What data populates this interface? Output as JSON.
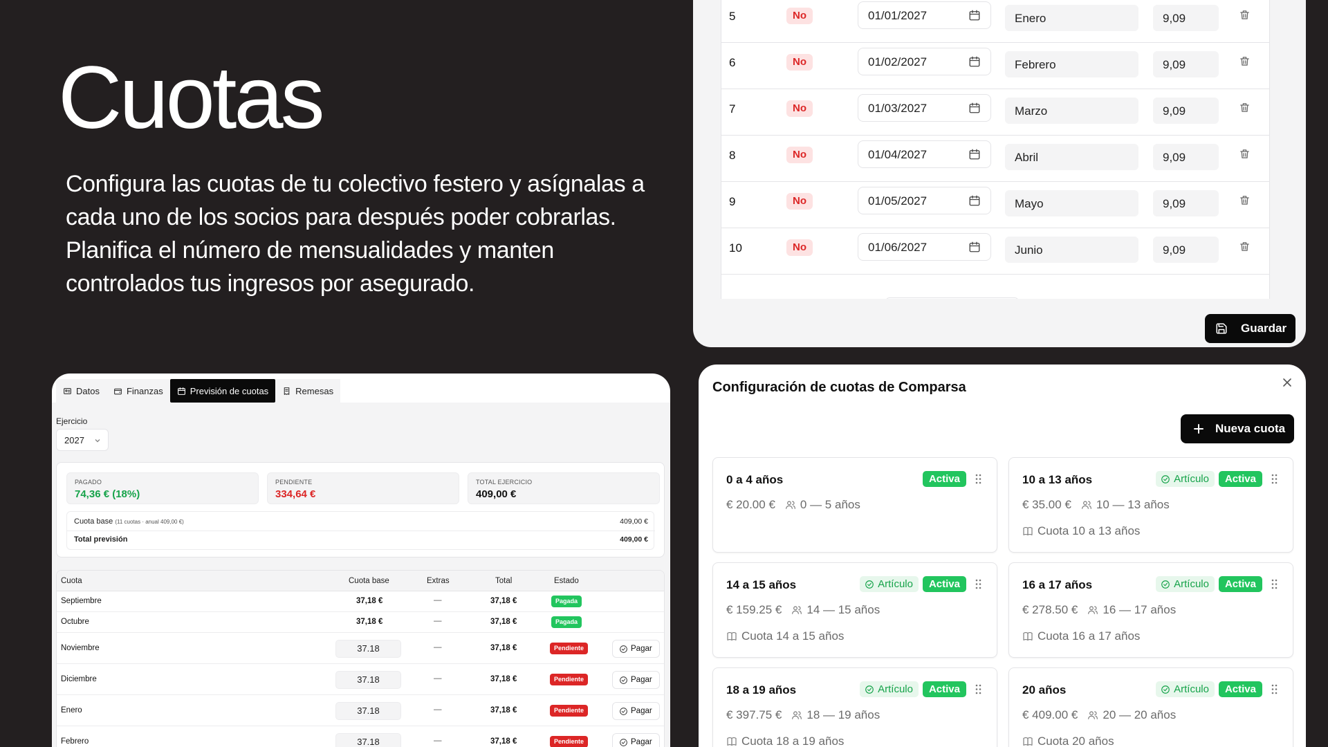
{
  "hero": {
    "title": "Cuotas",
    "description": "Configura las cuotas de tu colectivo festero y asígnalas a cada uno de los socios para después poder cobrarlas. Planifica el número de mensualidades y manten controlados tus ingresos por asegurado."
  },
  "installments": {
    "rows": [
      {
        "num": "5",
        "paid": "No",
        "date": "01/01/2027",
        "month": "Enero",
        "amount": "9,09"
      },
      {
        "num": "6",
        "paid": "No",
        "date": "01/02/2027",
        "month": "Febrero",
        "amount": "9,09"
      },
      {
        "num": "7",
        "paid": "No",
        "date": "01/03/2027",
        "month": "Marzo",
        "amount": "9,09"
      },
      {
        "num": "8",
        "paid": "No",
        "date": "01/04/2027",
        "month": "Abril",
        "amount": "9,09"
      },
      {
        "num": "9",
        "paid": "No",
        "date": "01/05/2027",
        "month": "Mayo",
        "amount": "9,09"
      },
      {
        "num": "10",
        "paid": "No",
        "date": "01/06/2027",
        "month": "Junio",
        "amount": "9,09"
      }
    ],
    "save_label": "Guardar"
  },
  "forecast": {
    "tabs": [
      {
        "label": "Datos",
        "icon": "id-card-icon",
        "active": false
      },
      {
        "label": "Finanzas",
        "icon": "wallet-icon",
        "active": false
      },
      {
        "label": "Previsión de cuotas",
        "icon": "calendar-icon",
        "active": true
      },
      {
        "label": "Remesas",
        "icon": "receipt-icon",
        "active": false
      }
    ],
    "ejercicio_label": "Ejercicio",
    "year": "2027",
    "stats": [
      {
        "label": "PAGADO",
        "value": "74,36 € (18%)",
        "color": "#16a34a"
      },
      {
        "label": "PENDIENTE",
        "value": "334,64 €",
        "color": "#dc2626"
      },
      {
        "label": "TOTAL EJERCICIO",
        "value": "409,00 €",
        "color": "#111111"
      }
    ],
    "breakdown": {
      "base_label": "Cuota base",
      "base_note": "(11 cuotas · anual 409,00 €)",
      "base_value": "409,00 €",
      "total_label": "Total previsión",
      "total_value": "409,00 €"
    },
    "columns": [
      "Cuota",
      "Cuota base",
      "Extras",
      "Total",
      "Estado"
    ],
    "rows": [
      {
        "cuota": "Septiembre",
        "base": "37,18 €",
        "editable": false,
        "extras": "—",
        "total": "37,18 €",
        "estado": "Pagada",
        "action": ""
      },
      {
        "cuota": "Octubre",
        "base": "37,18 €",
        "editable": false,
        "extras": "—",
        "total": "37,18 €",
        "estado": "Pagada",
        "action": ""
      },
      {
        "cuota": "Noviembre",
        "base": "37.18",
        "editable": true,
        "extras": "—",
        "total": "37,18 €",
        "estado": "Pendiente",
        "action": "Pagar"
      },
      {
        "cuota": "Diciembre",
        "base": "37.18",
        "editable": true,
        "extras": "—",
        "total": "37,18 €",
        "estado": "Pendiente",
        "action": "Pagar"
      },
      {
        "cuota": "Enero",
        "base": "37.18",
        "editable": true,
        "extras": "—",
        "total": "37,18 €",
        "estado": "Pendiente",
        "action": "Pagar"
      },
      {
        "cuota": "Febrero",
        "base": "37.18",
        "editable": true,
        "extras": "—",
        "total": "37,18 €",
        "estado": "Pendiente",
        "action": "Pagar"
      }
    ]
  },
  "config": {
    "title": "Configuración de cuotas de Comparsa",
    "new_label": "Nueva cuota",
    "cards": [
      {
        "title": "0 a 4 años",
        "articulo": "",
        "activa": "Activa",
        "price": "€ 20.00 €",
        "ages": "0 — 5 años",
        "item": ""
      },
      {
        "title": "10 a 13 años",
        "articulo": "Artículo",
        "activa": "Activa",
        "price": "€ 35.00 €",
        "ages": "10 — 13 años",
        "item": "Cuota 10 a 13 años"
      },
      {
        "title": "14 a 15 años",
        "articulo": "Artículo",
        "activa": "Activa",
        "price": "€ 159.25 €",
        "ages": "14 — 15 años",
        "item": "Cuota 14 a 15 años"
      },
      {
        "title": "16 a 17 años",
        "articulo": "Artículo",
        "activa": "Activa",
        "price": "€ 278.50 €",
        "ages": "16 — 17 años",
        "item": "Cuota 16 a 17 años"
      },
      {
        "title": "18 a 19 años",
        "articulo": "Artículo",
        "activa": "Activa",
        "price": "€ 397.75 €",
        "ages": "18 — 19 años",
        "item": "Cuota 18 a 19 años"
      },
      {
        "title": "20 años",
        "articulo": "Artículo",
        "activa": "Activa",
        "price": "€ 409.00 €",
        "ages": "20 — 20 años",
        "item": "Cuota 20 años"
      }
    ]
  },
  "colors": {
    "background": "#231f20",
    "accent_green": "#22c55e",
    "danger_red": "#dc2626",
    "primary_dark": "#0a0a0a"
  }
}
